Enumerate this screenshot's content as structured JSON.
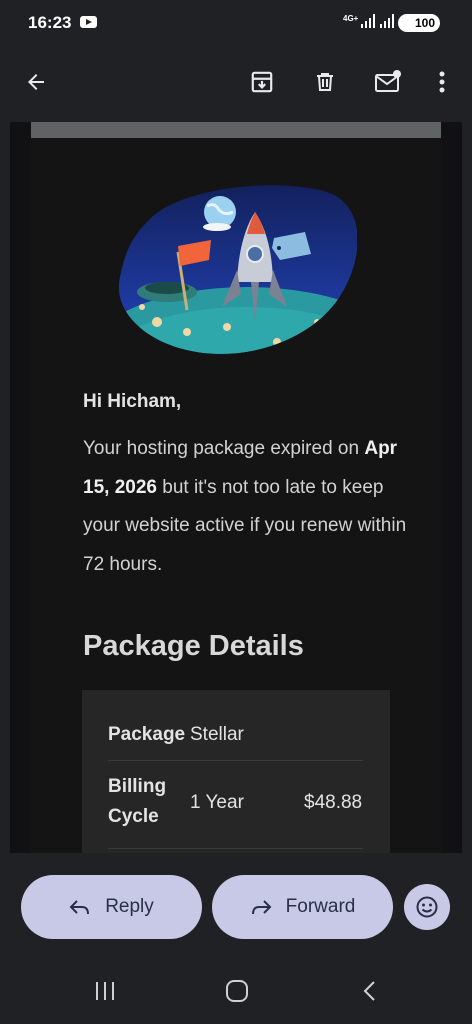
{
  "status_bar": {
    "time": "16:23",
    "network": "4G+",
    "battery": "100",
    "icons": [
      "youtube-icon",
      "signal-icon",
      "battery-icon"
    ]
  },
  "toolbar": {
    "icons": [
      "back-arrow-icon",
      "archive-icon",
      "delete-icon",
      "mark-unread-icon",
      "more-vert-icon"
    ]
  },
  "email": {
    "greeting": "Hi Hicham,",
    "body_prefix": "Your hosting package expired on",
    "expiry_date": "Apr 15, 2026",
    "body_suffix": "but it's not too late to keep your website active if you renew within 72 hours.",
    "section_title": "Package Details",
    "details": {
      "package_label": "Package",
      "package_value": "Stellar",
      "billing_label_line1": "Billing",
      "billing_label_line2": "Cycle",
      "billing_value": "1 Year",
      "billing_price": "$48.88"
    }
  },
  "actions": {
    "reply_label": "Reply",
    "forward_label": "Forward"
  },
  "colors": {
    "background": "#202124",
    "email_background": "#141414",
    "button_background": "#c7c9e6",
    "details_background": "#262626"
  }
}
